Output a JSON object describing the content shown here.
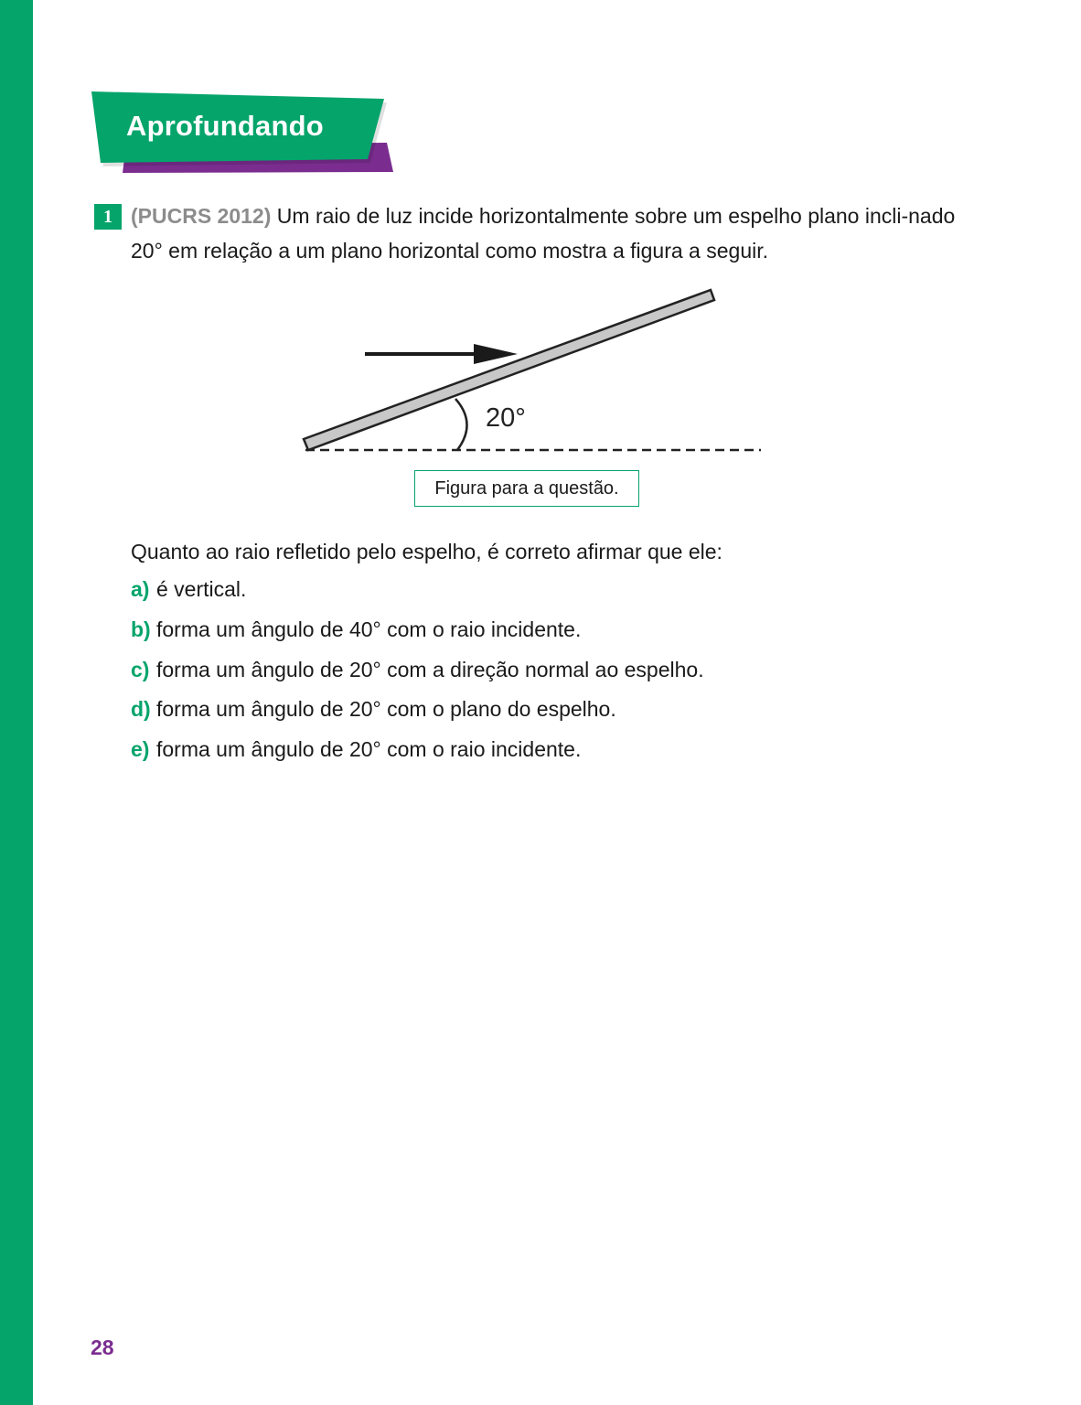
{
  "section": {
    "title": "Aprofundando"
  },
  "question": {
    "number": "1",
    "source": "(PUCRS 2012)",
    "text": " Um raio de luz incide horizontalmente sobre um espelho plano incli-nado 20° em relação a um plano horizontal como mostra a figura a seguir."
  },
  "figure": {
    "angle_label": "20°",
    "caption": "Figura para a questão."
  },
  "prompt": "Quanto ao raio refletido pelo espelho, é correto afirmar que ele:",
  "options": [
    {
      "letter": "a)",
      "text": "é vertical."
    },
    {
      "letter": "b)",
      "text": "forma um ângulo de 40° com o raio incidente."
    },
    {
      "letter": "c)",
      "text": "forma um ângulo de 20° com a direção normal ao espelho."
    },
    {
      "letter": "d)",
      "text": "forma um ângulo de 20° com o plano do espelho."
    },
    {
      "letter": "e)",
      "text": "forma um ângulo de 20° com o raio incidente."
    }
  ],
  "page_number": "28",
  "colors": {
    "accent_green": "#05a46b",
    "accent_purple": "#7a2d8f"
  }
}
